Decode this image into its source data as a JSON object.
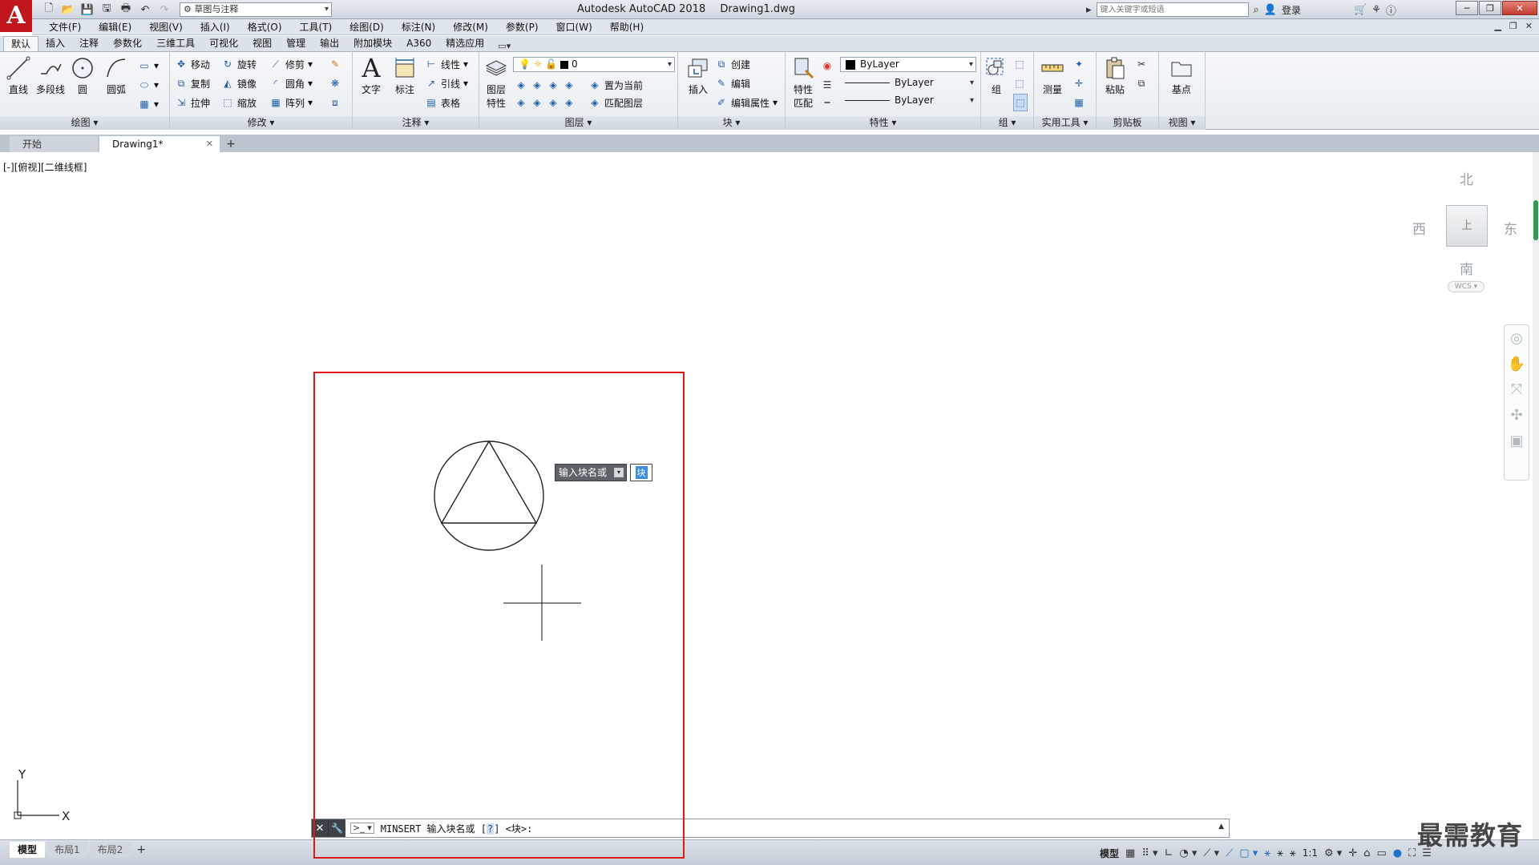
{
  "app": {
    "title": "Autodesk AutoCAD 2018",
    "document": "Drawing1.dwg",
    "logo_letter": "A",
    "brand_color": "#c0161c"
  },
  "quick_access": {
    "workspace": "草图与注释",
    "icons": [
      "new-icon",
      "open-icon",
      "save-icon",
      "save-as-icon",
      "print-icon",
      "undo-icon",
      "redo-icon"
    ]
  },
  "title_right": {
    "search_placeholder": "键入关键字或短语",
    "login": "登录"
  },
  "menu": [
    "文件(F)",
    "编辑(E)",
    "视图(V)",
    "插入(I)",
    "格式(O)",
    "工具(T)",
    "绘图(D)",
    "标注(N)",
    "修改(M)",
    "参数(P)",
    "窗口(W)",
    "帮助(H)"
  ],
  "ribbon_tabs": [
    {
      "label": "默认",
      "active": true
    },
    {
      "label": "插入"
    },
    {
      "label": "注释"
    },
    {
      "label": "参数化"
    },
    {
      "label": "三维工具"
    },
    {
      "label": "可视化"
    },
    {
      "label": "视图"
    },
    {
      "label": "管理"
    },
    {
      "label": "输出"
    },
    {
      "label": "附加模块"
    },
    {
      "label": "A360"
    },
    {
      "label": "精选应用"
    }
  ],
  "ribbon": {
    "draw": {
      "title": "绘图",
      "line": "直线",
      "polyline": "多段线",
      "circle": "圆",
      "arc": "圆弧"
    },
    "modify": {
      "title": "修改",
      "move": "移动",
      "rotate": "旋转",
      "trim": "修剪",
      "copy": "复制",
      "mirror": "镜像",
      "fillet": "圆角",
      "stretch": "拉伸",
      "scale": "缩放",
      "array": "阵列"
    },
    "annotation": {
      "title": "注释",
      "text": "文字",
      "dimension": "标注",
      "linear": "线性",
      "leader": "引线",
      "table": "表格"
    },
    "layers": {
      "title": "图层",
      "properties_line1": "图层",
      "properties_line2": "特性",
      "current_layer": "0",
      "set_current": "置为当前",
      "match_layer": "匹配图层"
    },
    "block": {
      "title": "块",
      "insert": "插入",
      "create": "创建",
      "edit": "编辑",
      "edit_attr": "编辑属性"
    },
    "properties": {
      "title": "特性",
      "match_line1": "特性",
      "match_line2": "匹配",
      "color": "ByLayer",
      "linetype": "ByLayer",
      "lineweight": "ByLayer"
    },
    "groups": {
      "title": "组",
      "group": "组"
    },
    "utilities": {
      "title": "实用工具",
      "measure": "测量"
    },
    "clipboard": {
      "title": "剪贴板",
      "paste": "粘贴"
    },
    "view": {
      "title": "视图",
      "base": "基点"
    }
  },
  "doc_tabs": [
    {
      "label": "开始"
    },
    {
      "label": "Drawing1*",
      "active": true
    }
  ],
  "canvas": {
    "viewport_label": "[-][俯视][二维线框]",
    "viewcube": {
      "north": "北",
      "south": "南",
      "east": "东",
      "west": "西",
      "face": "上",
      "wcs": "WCS"
    },
    "ucs": {
      "x": "X",
      "y": "Y"
    }
  },
  "dynamic_input": {
    "label": "输入块名或",
    "value": "块"
  },
  "command_line": {
    "prefix": "MINSERT 输入块名或 [",
    "option": "?",
    "suffix": "] <块>:"
  },
  "layout_tabs": [
    {
      "label": "模型",
      "active": true
    },
    {
      "label": "布局1"
    },
    {
      "label": "布局2"
    }
  ],
  "status": {
    "model": "模型",
    "scale": "1:1"
  },
  "watermark": "最需教育",
  "highlight_color": "#e01818"
}
